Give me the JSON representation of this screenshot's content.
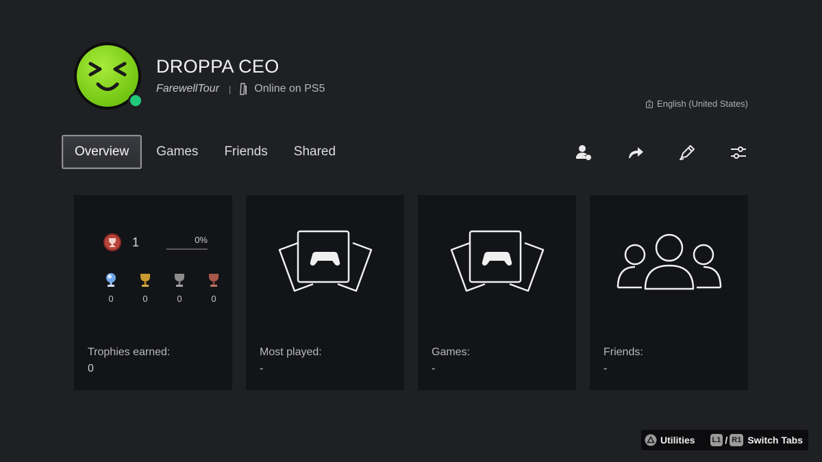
{
  "profile": {
    "name": "DROPPA CEO",
    "online_id": "FarewellTour",
    "separator": "|",
    "status": "Online on PS5",
    "language": "English (United States)"
  },
  "tabs": [
    {
      "label": "Overview",
      "active": true
    },
    {
      "label": "Games",
      "active": false
    },
    {
      "label": "Friends",
      "active": false
    },
    {
      "label": "Shared",
      "active": false
    }
  ],
  "actions": [
    {
      "icon": "add-friend-icon"
    },
    {
      "icon": "share-icon"
    },
    {
      "icon": "edit-pencil-icon"
    },
    {
      "icon": "settings-sliders-icon"
    }
  ],
  "cards": {
    "trophies": {
      "level": "1",
      "progress_text": "0%",
      "progress": 0,
      "platinum": "0",
      "gold": "0",
      "silver": "0",
      "bronze": "0",
      "label": "Trophies earned:",
      "value": "0"
    },
    "most_played": {
      "label": "Most played:",
      "value": "-",
      "icon": "game-cards-icon"
    },
    "games": {
      "label": "Games:",
      "value": "-",
      "icon": "game-cards-icon"
    },
    "friends": {
      "label": "Friends:",
      "value": "-",
      "icon": "friends-group-icon"
    }
  },
  "hints": {
    "utilities": "Utilities",
    "l1": "L1",
    "slash": "/",
    "r1": "R1",
    "switch_tabs": "Switch Tabs"
  },
  "colors": {
    "background": "#1f2023",
    "card": "#131417",
    "online": "#20c97a",
    "avatar": "#8ad61a"
  }
}
